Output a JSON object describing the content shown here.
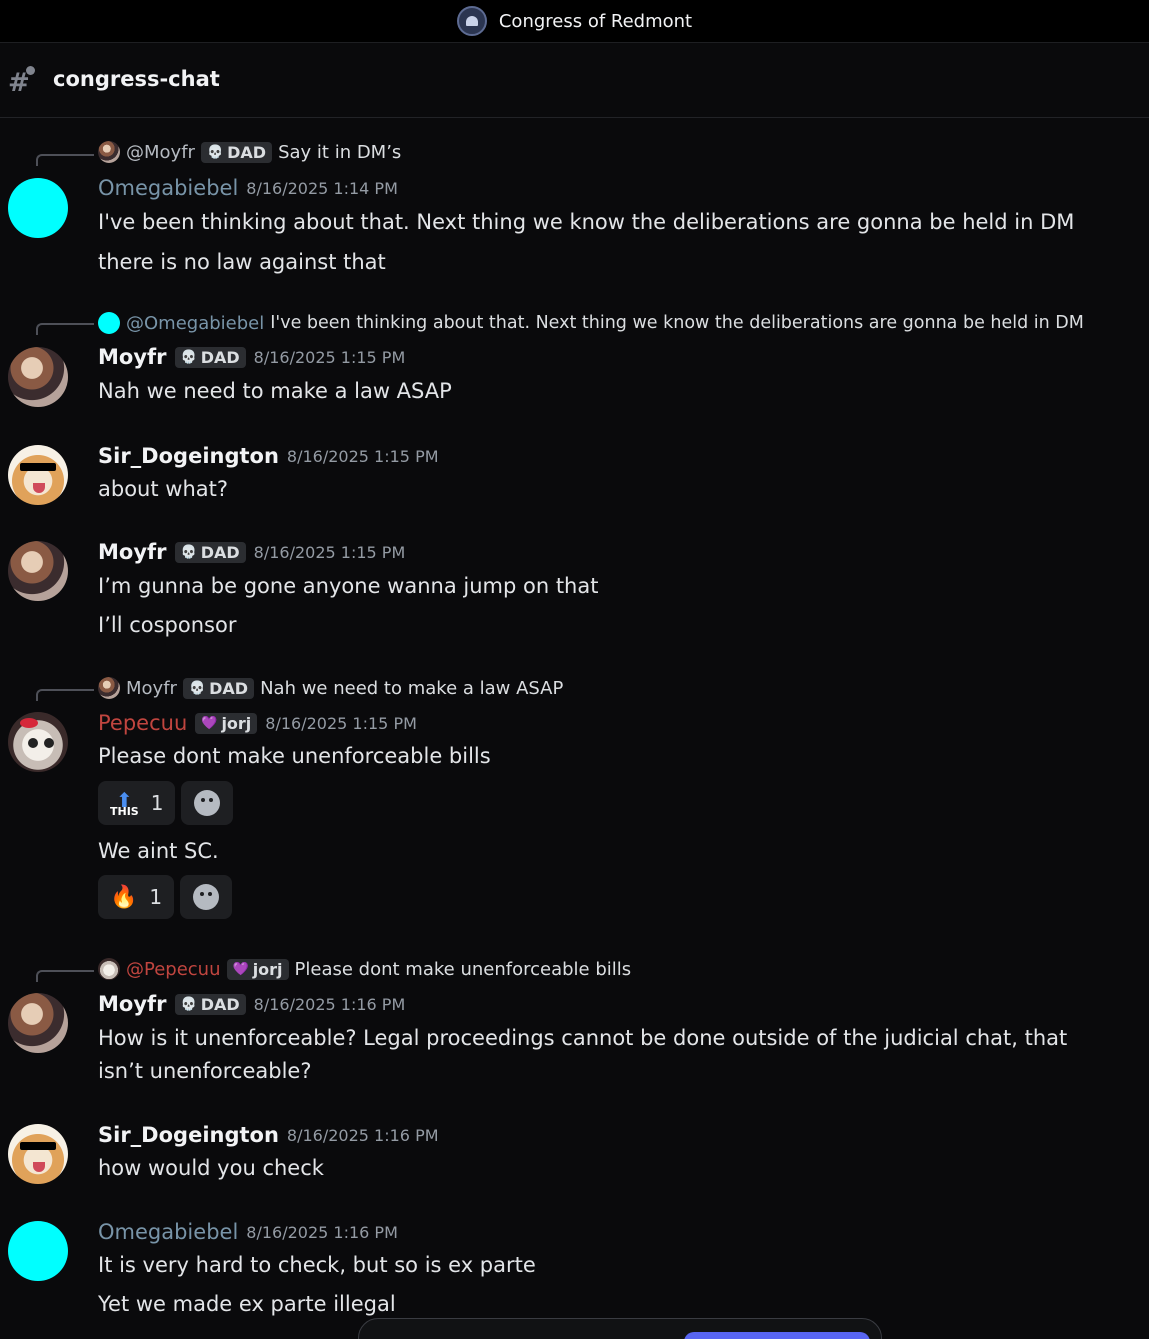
{
  "titlebar": {
    "server_name": "Congress of Redmont"
  },
  "channel": {
    "name": "congress-chat"
  },
  "colors": {
    "accent": "#5865f2",
    "cyan_avatar": "#00ffff",
    "username_slate": "#7894a8",
    "username_red": "#c0453f"
  },
  "messages": [
    {
      "reply": {
        "name": "@Moyfr",
        "tag": "DAD",
        "text": "Say it in DM’s"
      },
      "author": "Omegabiebel",
      "timestamp": "8/16/2025 1:14 PM",
      "lines": [
        "I've been thinking about that. Next thing we know the deliberations are gonna be held in DM",
        "there is no law against that"
      ]
    },
    {
      "reply": {
        "name": "@Omegabiebel",
        "text": "I've been thinking about that. Next thing we know the deliberations are gonna be held in DM"
      },
      "author": "Moyfr",
      "tag": "DAD",
      "timestamp": "8/16/2025 1:15 PM",
      "lines": [
        "Nah we need to make a law ASAP"
      ]
    },
    {
      "author": "Sir_Dogeington",
      "timestamp": "8/16/2025 1:15 PM",
      "lines": [
        "about what?"
      ]
    },
    {
      "author": "Moyfr",
      "tag": "DAD",
      "timestamp": "8/16/2025 1:15 PM",
      "lines": [
        "I’m gunna be gone anyone wanna jump on that",
        "I’ll cosponsor"
      ]
    },
    {
      "reply": {
        "name": "Moyfr",
        "tag": "DAD",
        "text": "Nah we need to make a law ASAP"
      },
      "author": "Pepecuu",
      "tag": "jorj",
      "timestamp": "8/16/2025 1:15 PM",
      "lines": [
        "Please dont make unenforceable bills",
        "We aint SC."
      ],
      "reactions": [
        {
          "emoji": "this-up-arrow-emoji",
          "label": "THIS",
          "count": "1"
        },
        {
          "emoji": "fire-emoji",
          "count": "1"
        }
      ]
    },
    {
      "reply": {
        "name": "@Pepecuu",
        "tag": "jorj",
        "text": "Please dont make unenforceable bills"
      },
      "author": "Moyfr",
      "tag": "DAD",
      "timestamp": "8/16/2025 1:16 PM",
      "lines": [
        "How is it unenforceable? Legal proceedings cannot be done outside of the judicial chat, that isn’t unenforceable?"
      ]
    },
    {
      "author": "Sir_Dogeington",
      "timestamp": "8/16/2025 1:16 PM",
      "lines": [
        "how would you check"
      ]
    },
    {
      "author": "Omegabiebel",
      "timestamp": "8/16/2025 1:16 PM",
      "lines": [
        "It is very hard to check, but so is ex parte",
        "Yet we made ex parte illegal"
      ]
    }
  ]
}
